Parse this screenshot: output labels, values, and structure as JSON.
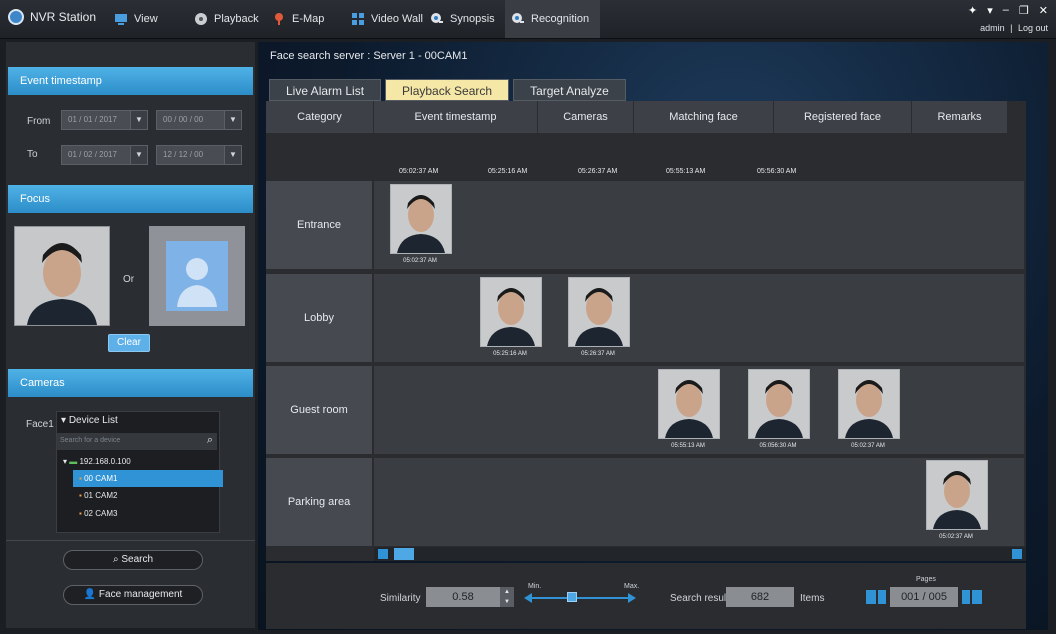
{
  "app": {
    "name": "NVR Station"
  },
  "nav": [
    {
      "label": "View"
    },
    {
      "label": "Playback"
    },
    {
      "label": "E-Map"
    },
    {
      "label": "Video Wall"
    },
    {
      "label": "Synopsis"
    },
    {
      "label": "Recognition"
    }
  ],
  "user": {
    "name": "admin",
    "separator": "|",
    "logout": "Log out"
  },
  "event_ts": {
    "title": "Event timestamp",
    "from_label": "From",
    "from_date": "01 / 01 / 2017",
    "from_time": "00 / 00 / 00",
    "to_label": "To",
    "to_date": "01 / 02 / 2017",
    "to_time": "12 / 12 / 00"
  },
  "focus": {
    "title": "Focus",
    "or": "Or",
    "clear": "Clear"
  },
  "cameras": {
    "title": "Cameras",
    "face_label": "Face1",
    "device_list": "Device List",
    "search_placeholder": "Search for a device",
    "ip": "192.168.0.100",
    "items": [
      "00 CAM1",
      "01 CAM2",
      "02 CAM3"
    ]
  },
  "actions": {
    "search": "Search",
    "face_mgmt": "Face management"
  },
  "server": {
    "label": "Face search server : Server 1 - 00CAM1"
  },
  "tabs": [
    "Live Alarm List",
    "Playback Search",
    "Target Analyze"
  ],
  "columns": [
    "Category",
    "Event timestamp",
    "Cameras",
    "Matching face",
    "Registered face",
    "Remarks"
  ],
  "timestamps": [
    "05:02:37 AM",
    "05:25:16 AM",
    "05:26:37 AM",
    "05:55:13  AM",
    "05:56:30 AM"
  ],
  "rows": [
    "Entrance",
    "Lobby",
    "Guest room",
    "Parking area"
  ],
  "thumbs": [
    "05:02:37 AM",
    "05:25:16 AM",
    "05:26:37 AM",
    "05:55:13  AM",
    "05:056:30 AM",
    "05:02:37 AM",
    "05:02:37 AM"
  ],
  "bottom": {
    "similarity_label": "Similarity",
    "similarity": "0.58",
    "min": "Min.",
    "max": "Max.",
    "result_label": "Search result",
    "result": "682",
    "items": "Items",
    "pages_label": "Pages",
    "pages": "001 / 005"
  }
}
